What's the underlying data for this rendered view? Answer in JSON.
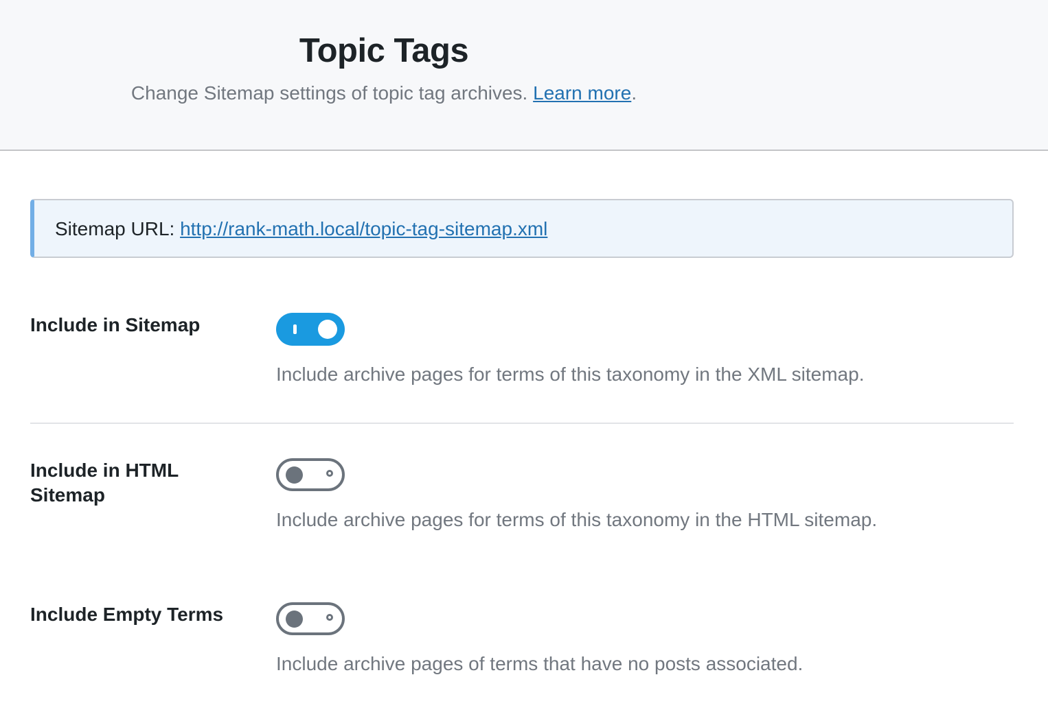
{
  "header": {
    "title": "Topic Tags",
    "description": "Change Sitemap settings of topic tag archives.",
    "learn_more": "Learn more",
    "period": "."
  },
  "notice": {
    "label": "Sitemap URL:",
    "url": "http://rank-math.local/topic-tag-sitemap.xml"
  },
  "fields": [
    {
      "label": "Include in Sitemap",
      "enabled": true,
      "description": "Include archive pages for terms of this taxonomy in the XML sitemap."
    },
    {
      "label": "Include in HTML Sitemap",
      "enabled": false,
      "description": "Include archive pages for terms of this taxonomy in the HTML sitemap."
    },
    {
      "label": "Include Empty Terms",
      "enabled": false,
      "description": "Include archive pages of terms that have no posts associated."
    }
  ],
  "colors": {
    "toggle_on": "#1a9ae0",
    "toggle_off": "#6b737c",
    "link": "#2271b1",
    "notice_accent": "#72aee6"
  }
}
